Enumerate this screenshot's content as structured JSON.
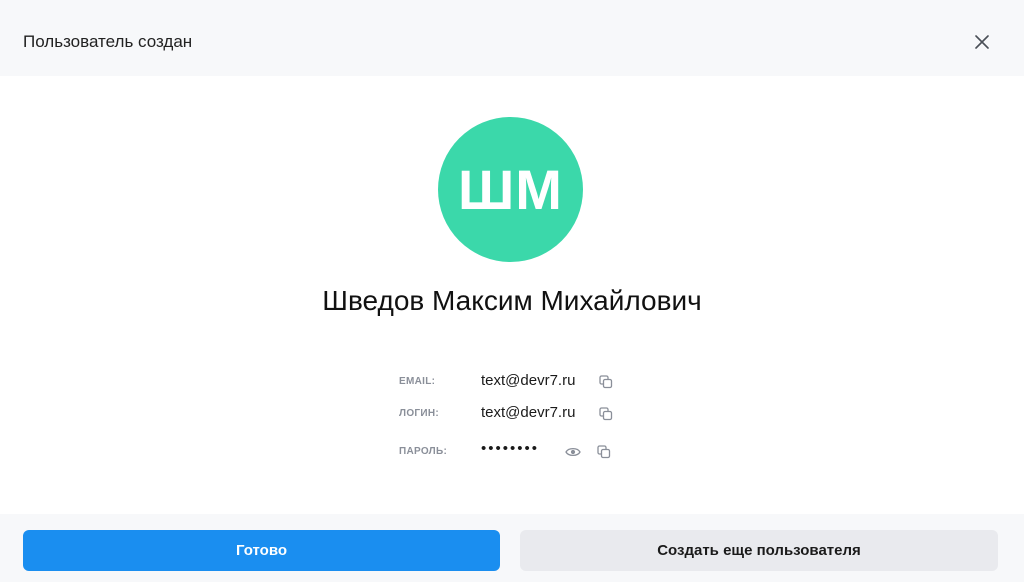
{
  "header": {
    "title": "Пользователь создан",
    "close_icon": "close-icon"
  },
  "user": {
    "initials": "ШМ",
    "avatar_color": "#3bd8aa",
    "full_name": "Шведов Максим Михайлович"
  },
  "fields": {
    "email": {
      "label": "EMAIL:",
      "value": "text@devr7.ru",
      "copy_icon": "copy-icon"
    },
    "login": {
      "label": "ЛОГИН:",
      "value": "text@devr7.ru",
      "copy_icon": "copy-icon"
    },
    "password": {
      "label": "ПАРОЛЬ:",
      "value": "••••••••",
      "show_icon": "eye-icon",
      "copy_icon": "copy-icon"
    }
  },
  "footer": {
    "done_label": "Готово",
    "create_more_label": "Создать еще пользователя",
    "primary_color": "#1a8ef0"
  }
}
